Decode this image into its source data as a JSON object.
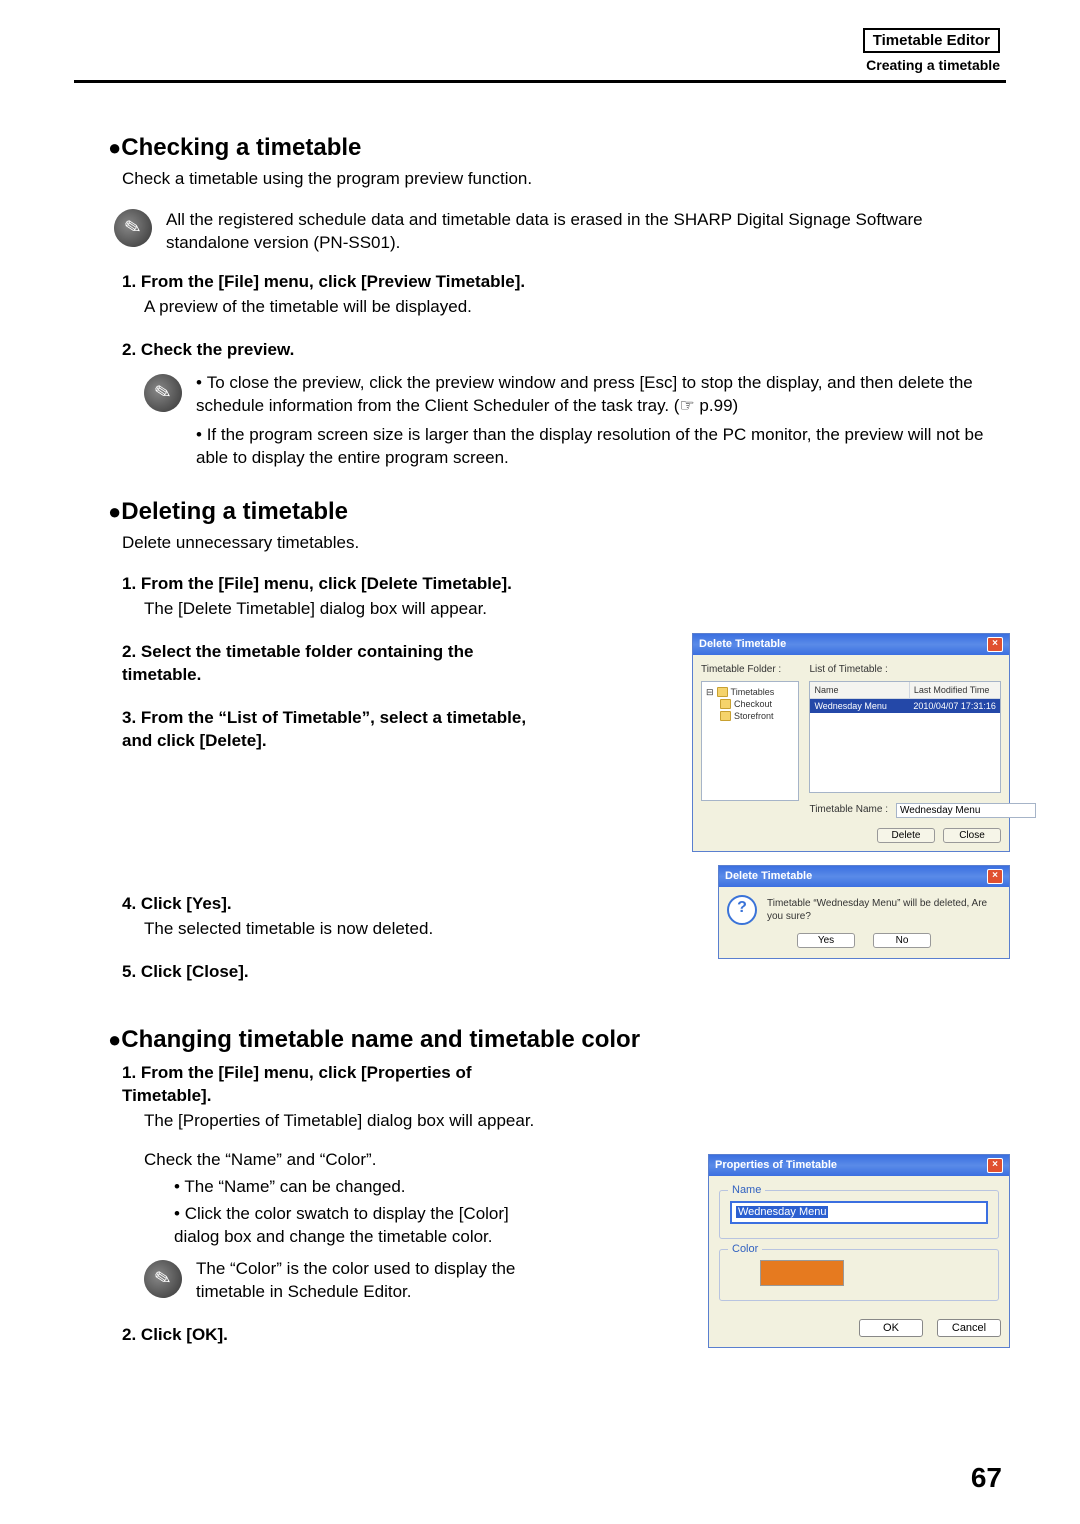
{
  "header": {
    "title": "Timetable Editor",
    "subtitle": "Creating a timetable"
  },
  "page_number": "67",
  "sections": {
    "checking": {
      "heading": "Checking a timetable",
      "intro": "Check a timetable using the program preview function.",
      "tip": "All the registered schedule data and timetable data is erased in the SHARP Digital Signage Software standalone version (PN-SS01).",
      "steps": [
        {
          "title": "From the [File] menu, click [Preview Timetable].",
          "body": "A preview of the timetable will be displayed."
        },
        {
          "title": "Check the preview."
        }
      ],
      "inner_tips": [
        "To close the preview, click the preview window and press [Esc] to stop the display, and then delete the schedule information from the Client Scheduler of the task tray. (☞ p.99)",
        "If the program screen size is larger than the display resolution of the PC monitor, the preview will not be able to display the entire program screen."
      ]
    },
    "deleting": {
      "heading": "Deleting a timetable",
      "intro": "Delete unnecessary timetables.",
      "steps": [
        {
          "title": "From the [File] menu, click [Delete Timetable].",
          "body": "The [Delete Timetable] dialog box will appear."
        },
        {
          "title": "Select the timetable folder containing the timetable."
        },
        {
          "title": "From the “List of Timetable”, select a timetable, and click [Delete]."
        },
        {
          "title": "Click [Yes].",
          "body": "The selected timetable is now deleted."
        },
        {
          "title": "Click [Close]."
        }
      ]
    },
    "changing": {
      "heading": "Changing timetable name and timetable color",
      "steps": [
        {
          "title": "From the [File] menu, click [Properties of Timetable].",
          "body": "The [Properties of Timetable] dialog box will appear."
        },
        {
          "title": "Click [OK]."
        }
      ],
      "check_line": "Check the “Name” and “Color”.",
      "sub_bullets": [
        "The “Name” can be changed.",
        "Click the color swatch to display the [Color] dialog box and change the timetable color."
      ],
      "color_tip": "The “Color” is the color used to display the timetable in Schedule Editor."
    }
  },
  "figures": {
    "delete_dialog": {
      "title": "Delete Timetable",
      "tree_label": "Timetable Folder :",
      "tree_root": "Timetables",
      "tree_items": [
        "Checkout",
        "Storefront"
      ],
      "list_label": "List of Timetable :",
      "columns": {
        "name": "Name",
        "time": "Last Modified Time"
      },
      "row": {
        "name": "Wednesday Menu",
        "time": "2010/04/07 17:31:16"
      },
      "name_label": "Timetable Name :",
      "name_value": "Wednesday Menu",
      "buttons": {
        "delete": "Delete",
        "close": "Close"
      }
    },
    "confirm_dialog": {
      "title": "Delete Timetable",
      "message": "Timetable “Wednesday Menu” will be deleted, Are you sure?",
      "buttons": {
        "yes": "Yes",
        "no": "No"
      }
    },
    "properties_dialog": {
      "title": "Properties of Timetable",
      "name_label": "Name",
      "name_value": "Wednesday Menu",
      "color_label": "Color",
      "color_value": "#e67a1f",
      "buttons": {
        "ok": "OK",
        "cancel": "Cancel"
      }
    }
  }
}
